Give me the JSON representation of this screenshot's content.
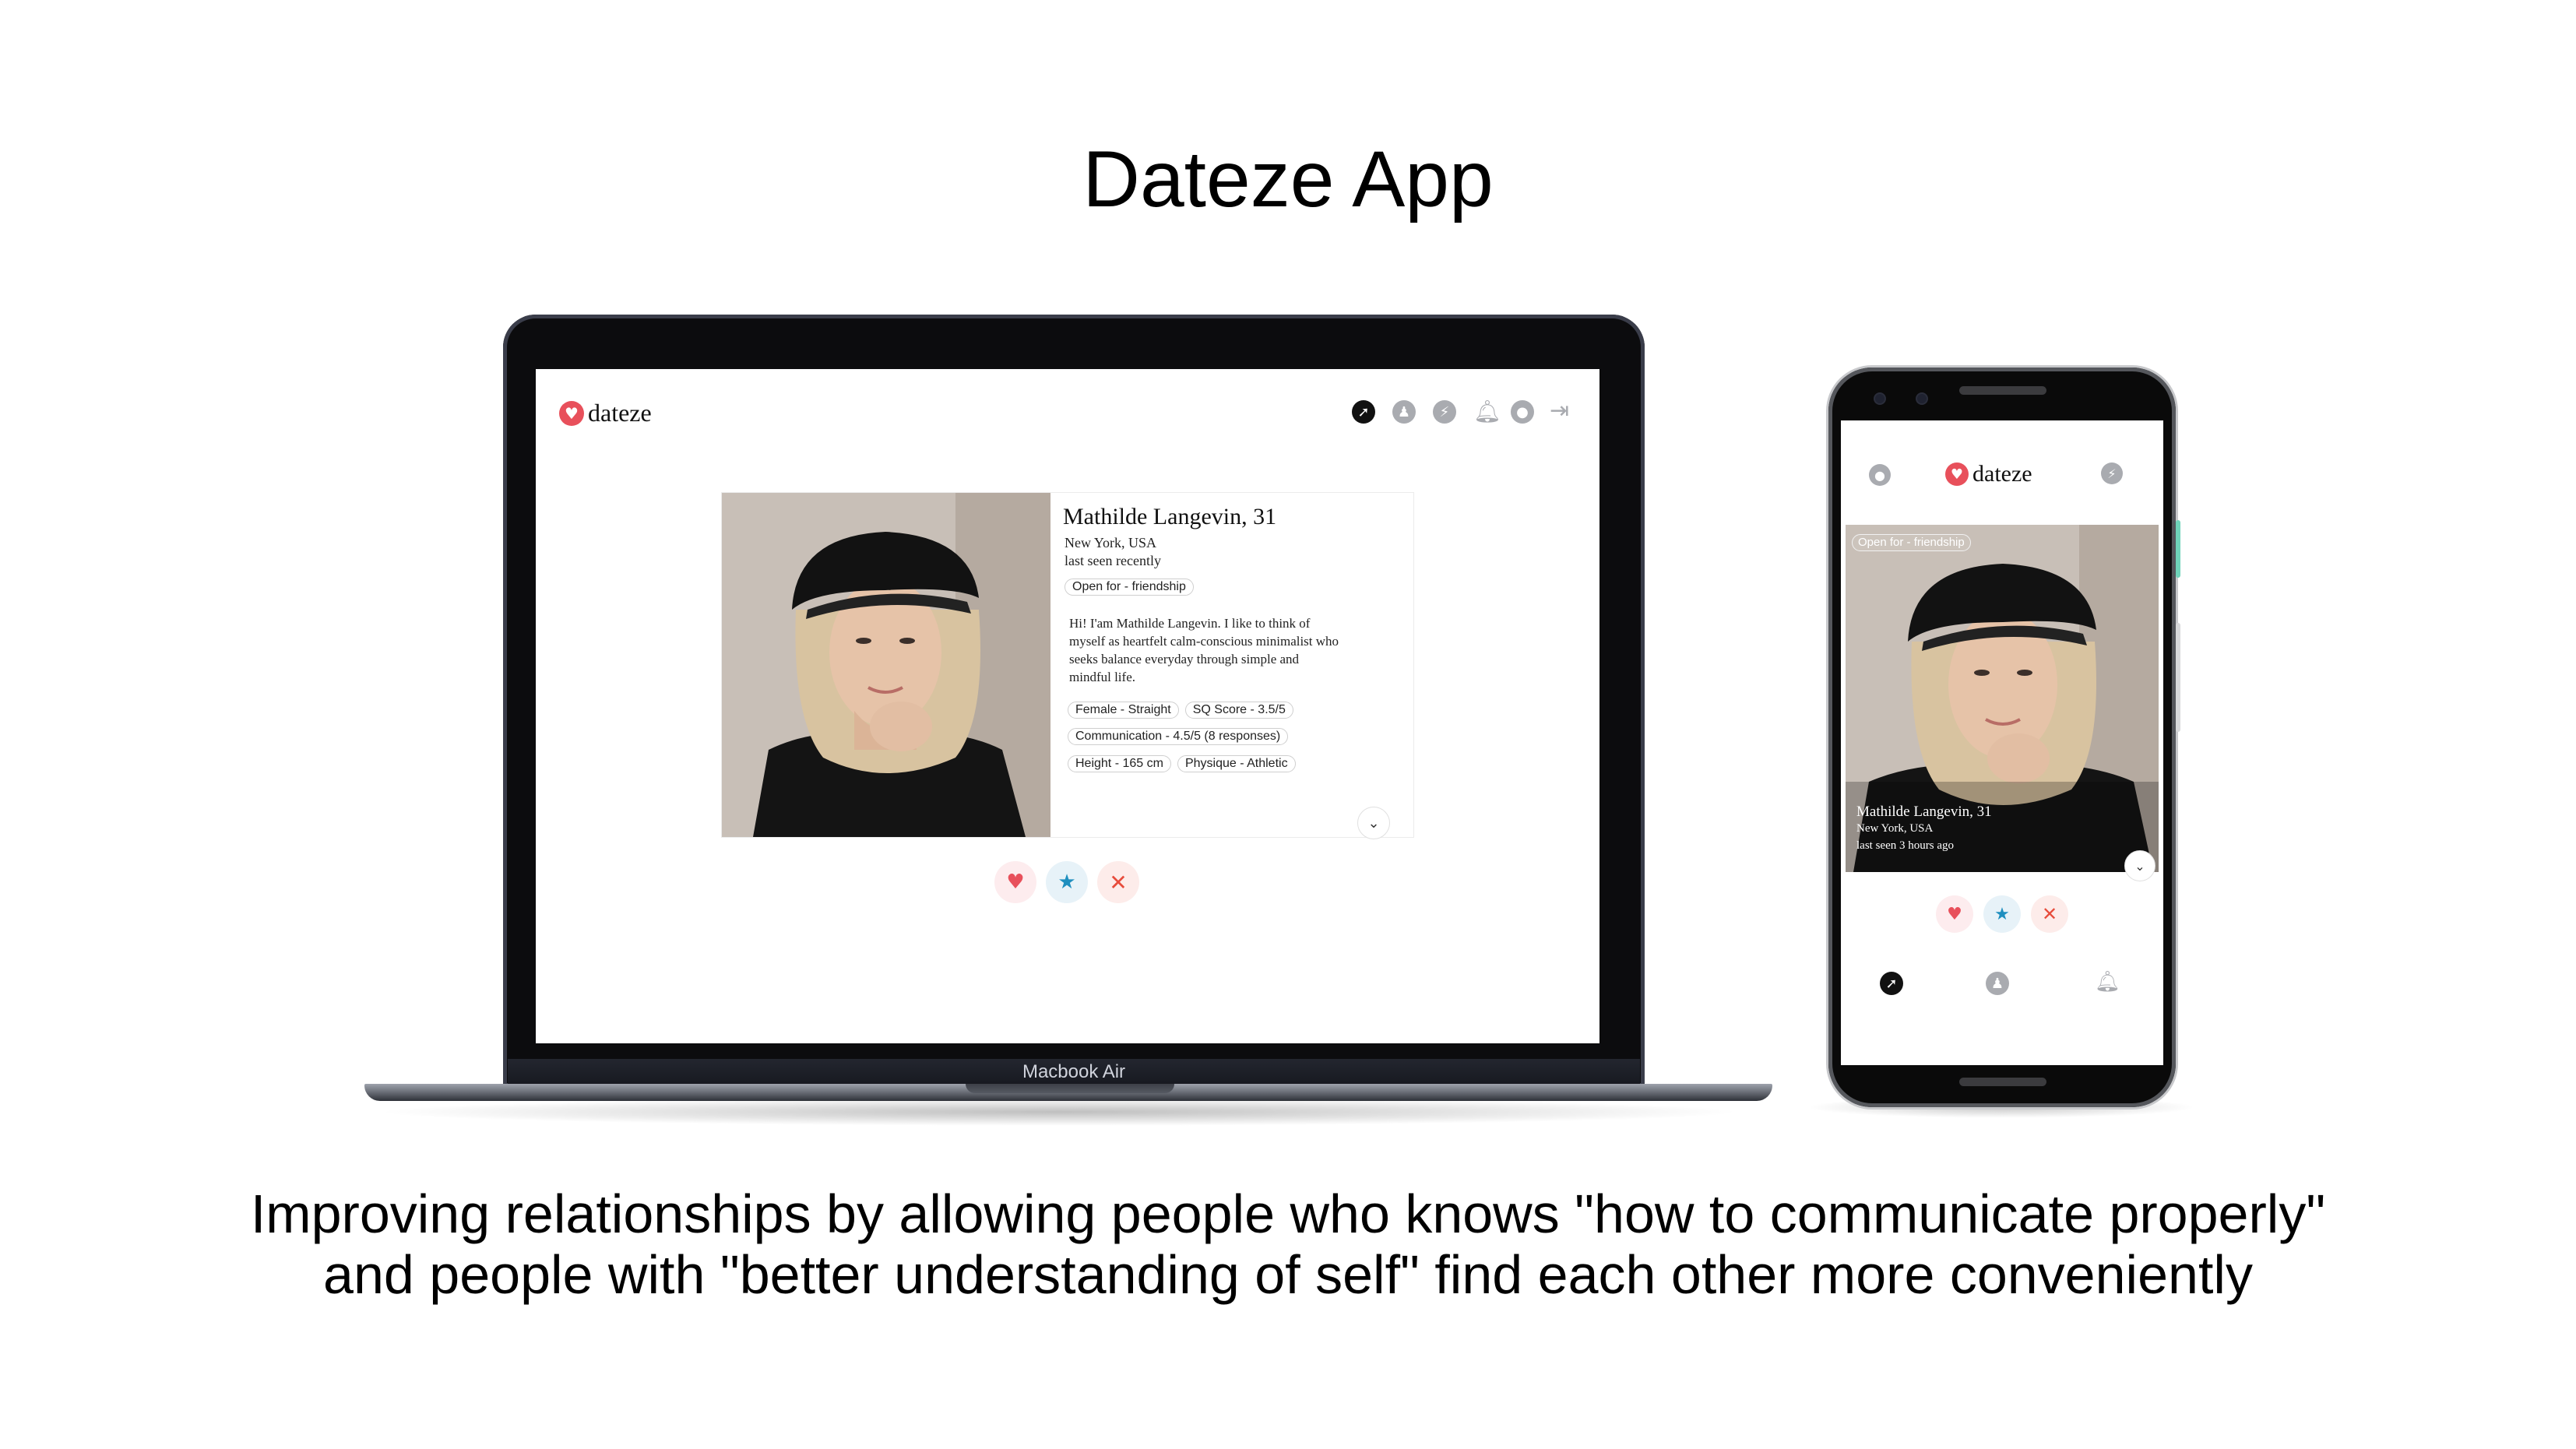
{
  "slide": {
    "title": "Dateze App",
    "tagline_line1": "Improving relationships by allowing people who knows \"how to communicate properly\"",
    "tagline_line2": "and people with \"better understanding of self\" find each other more conveniently"
  },
  "laptop": {
    "model_label": "Macbook Air",
    "app": {
      "logo_text": "dateze",
      "nav_icons": [
        "compass-icon",
        "user-badge-icon",
        "messenger-icon",
        "bell-icon",
        "profile-icon",
        "logout-icon"
      ],
      "active_nav": "compass-icon",
      "profile": {
        "name": "Mathilde Langevin, 31",
        "location": "New York, USA",
        "last_seen": "last seen recently",
        "intent": "Open for - friendship",
        "bio_lines": [
          "Hi! I'am Mathilde Langevin. I like to think of",
          "myself as heartfelt calm-conscious minimalist who",
          "seeks balance everyday through simple and",
          "mindful life."
        ],
        "tags": {
          "gender": "Female - Straight",
          "sq_score": "SQ Score - 3.5/5",
          "communication": "Communication - 4.5/5 (8 responses)",
          "height": "Height - 165 cm",
          "physique": "Physique - Athletic"
        }
      },
      "actions": {
        "like": "like-icon",
        "superlike": "star-icon",
        "pass": "close-icon"
      }
    }
  },
  "phone": {
    "app": {
      "logo_text": "dateze",
      "header_icons": [
        "profile-icon",
        "messenger-icon"
      ],
      "intent": "Open for - friendship",
      "name": "Mathilde Langevin, 31",
      "location": "New York, USA",
      "last_seen": "last seen 3 hours ago",
      "bottom_nav": [
        "compass-icon",
        "user-badge-icon",
        "bell-icon"
      ]
    }
  },
  "colors": {
    "brand": "#e8505b",
    "star": "#1f8fbf",
    "pass": "#e74c3c"
  }
}
